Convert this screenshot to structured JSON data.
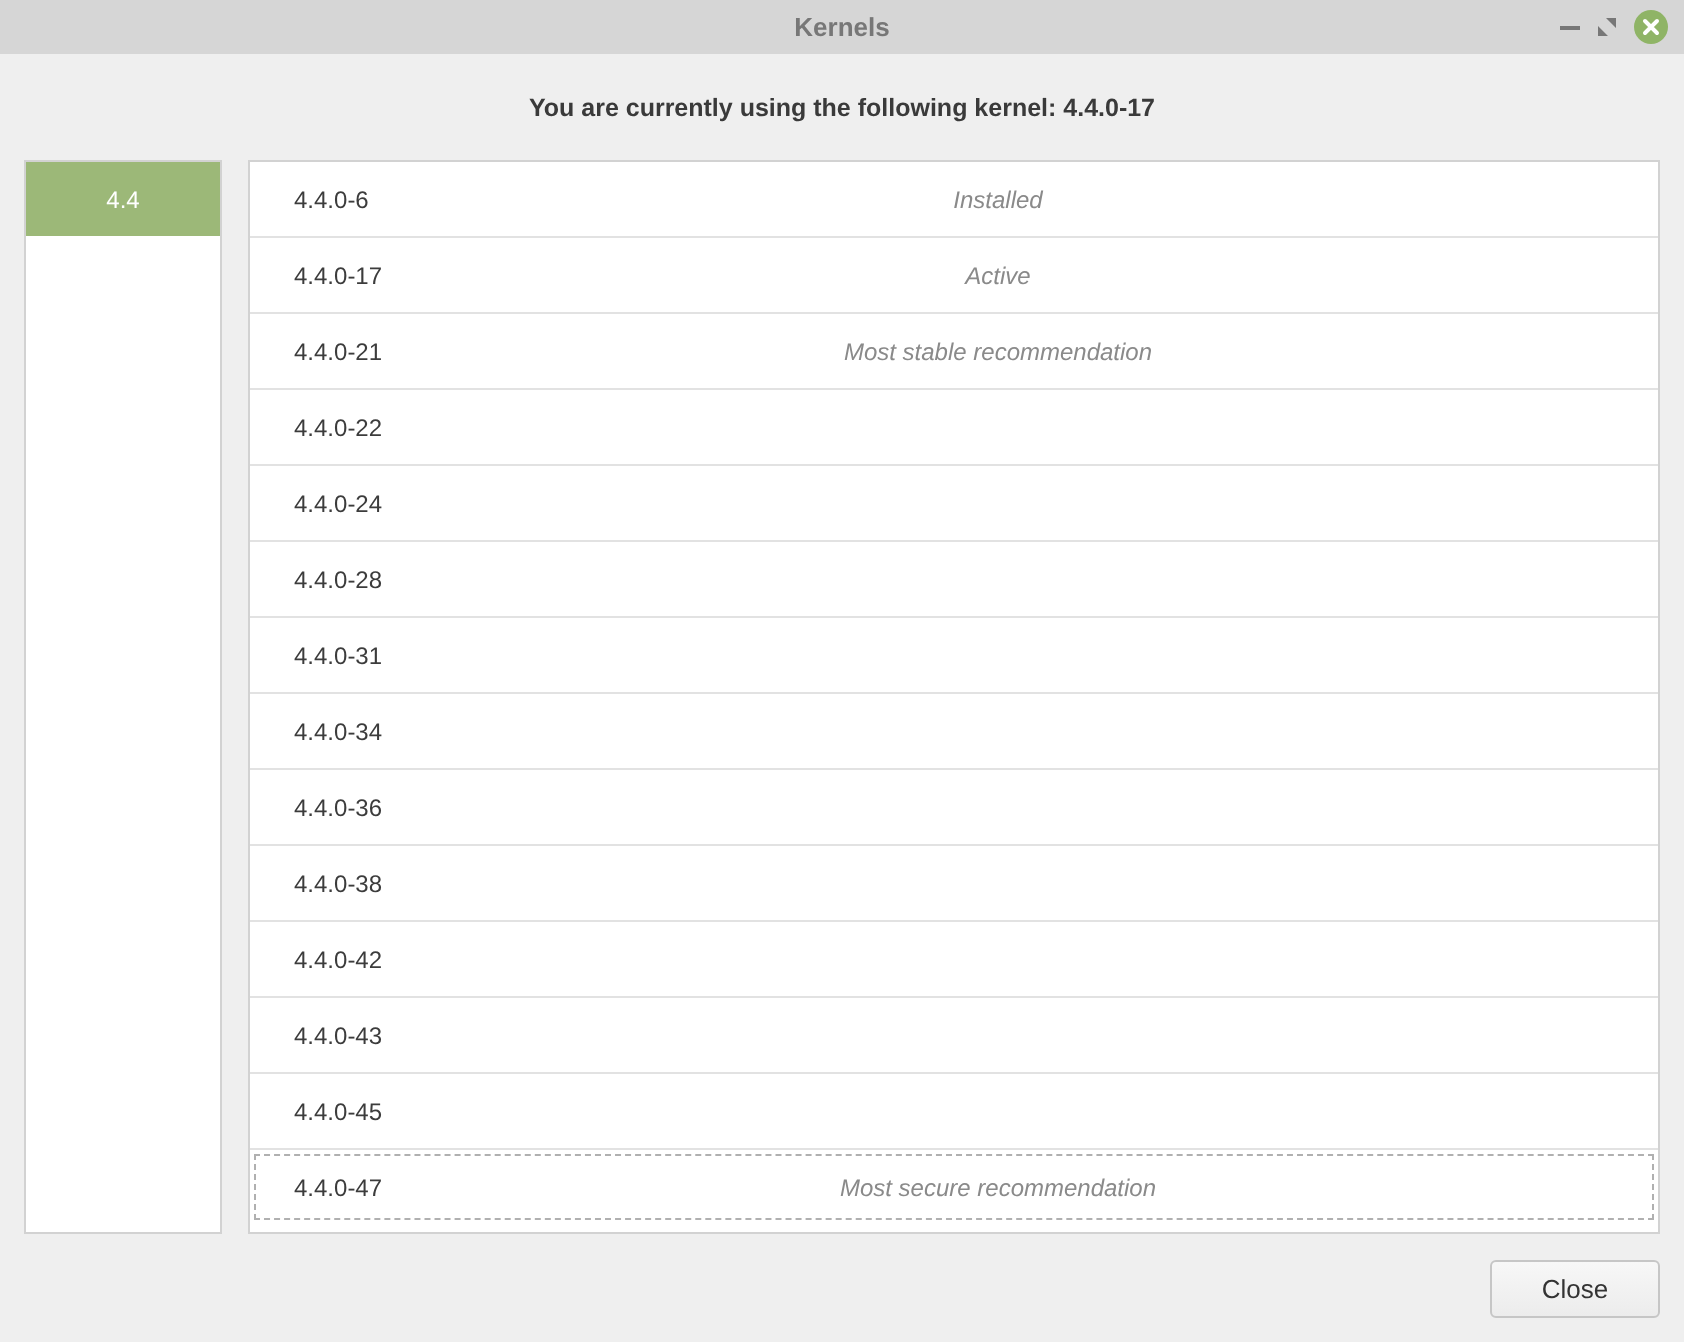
{
  "window": {
    "title": "Kernels"
  },
  "heading": "You are currently using the following kernel: 4.4.0-17",
  "series": [
    {
      "label": "4.4",
      "selected": true
    }
  ],
  "kernels": [
    {
      "version": "4.4.0-6",
      "note": "Installed",
      "focused": false
    },
    {
      "version": "4.4.0-17",
      "note": "Active",
      "focused": false
    },
    {
      "version": "4.4.0-21",
      "note": "Most stable recommendation",
      "focused": false
    },
    {
      "version": "4.4.0-22",
      "focused": false
    },
    {
      "version": "4.4.0-24",
      "focused": false
    },
    {
      "version": "4.4.0-28",
      "focused": false
    },
    {
      "version": "4.4.0-31",
      "focused": false
    },
    {
      "version": "4.4.0-34",
      "focused": false
    },
    {
      "version": "4.4.0-36",
      "focused": false
    },
    {
      "version": "4.4.0-38",
      "focused": false
    },
    {
      "version": "4.4.0-42",
      "focused": false
    },
    {
      "version": "4.4.0-43",
      "focused": false
    },
    {
      "version": "4.4.0-45",
      "focused": false
    },
    {
      "version": "4.4.0-47",
      "note": "Most secure recommendation",
      "focused": true
    }
  ],
  "buttons": [
    {
      "label": "Close"
    }
  ]
}
